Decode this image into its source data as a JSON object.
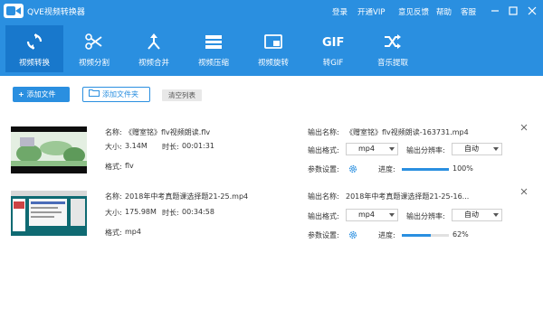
{
  "app": {
    "title": "QVE视频转换器",
    "top_links": [
      "登录",
      "开通VIP",
      "意见反馈",
      "帮助",
      "客服"
    ]
  },
  "toolbar": {
    "items": [
      {
        "label": "视频转换",
        "icon": "convert-icon",
        "active": true
      },
      {
        "label": "视频分割",
        "icon": "scissors-icon",
        "active": false
      },
      {
        "label": "视频合并",
        "icon": "merge-icon",
        "active": false
      },
      {
        "label": "视频压缩",
        "icon": "compress-icon",
        "active": false
      },
      {
        "label": "视频旋转",
        "icon": "rotate-icon",
        "active": false
      },
      {
        "label": "转GIF",
        "icon": "gif-icon",
        "active": false
      },
      {
        "label": "音乐提取",
        "icon": "shuffle-icon",
        "active": false
      }
    ]
  },
  "actions": {
    "add_file": "添加文件",
    "add_folder": "添加文件夹",
    "clear_list": "清空列表"
  },
  "labels": {
    "name": "名称:",
    "size": "大小:",
    "duration": "时长:",
    "format": "格式:",
    "output_name": "输出名称:",
    "output_format": "输出格式:",
    "output_resolution": "输出分辨率:",
    "params": "参数设置:",
    "progress": "进度:"
  },
  "files": [
    {
      "name": "《赠室铭》flv视频朗读.flv",
      "size": "3.14M",
      "duration": "00:01:31",
      "format": "flv",
      "output_name": "《赠室铭》flv视频朗读-163731.mp4",
      "output_format": "mp4",
      "output_resolution": "自动",
      "progress_text": "100%",
      "progress": 1.0
    },
    {
      "name": "2018年中考真题课选择题21-25.mp4",
      "size": "175.98M",
      "duration": "00:34:58",
      "format": "mp4",
      "output_name": "2018年中考真题课选择题21-25-16...",
      "output_format": "mp4",
      "output_resolution": "自动",
      "progress_text": "62%",
      "progress": 0.62
    }
  ],
  "colors": {
    "header": "#2a8fe0",
    "active_tab": "#1878cc",
    "accent": "#2a8fe0"
  }
}
